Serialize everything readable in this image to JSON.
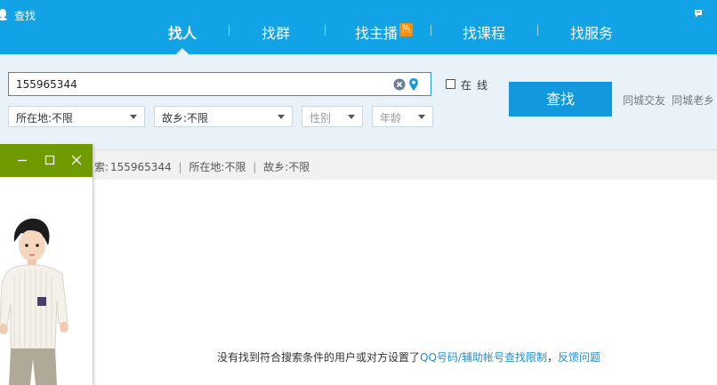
{
  "window": {
    "title": "查找"
  },
  "tabs": [
    {
      "label": "找人",
      "active": true
    },
    {
      "label": "找群",
      "active": false
    },
    {
      "label": "找主播",
      "active": false,
      "badge": "热"
    },
    {
      "label": "找课程",
      "active": false
    },
    {
      "label": "找服务",
      "active": false
    }
  ],
  "search": {
    "value": "155965344",
    "online_label": "在线",
    "online_checked": false,
    "button_label": "查找",
    "quick_links": [
      "同城交友",
      "同城老乡"
    ]
  },
  "filters": {
    "location": "所在地:不限",
    "hometown": "故乡:不限",
    "gender_placeholder": "性别",
    "age_placeholder": "年龄"
  },
  "summary": {
    "prefix": "索:",
    "keyword": "155965344",
    "location": "所在地:不限",
    "hometown": "故乡:不限"
  },
  "results": {
    "empty_text": "没有找到符合搜索条件的用户或对方设置了",
    "link_text": "QQ号码/辅助帐号查找限制",
    "separator": "，",
    "feedback_link": "反馈问题"
  },
  "colors": {
    "accent": "#12a2e6",
    "button": "#1298dd",
    "pet_titlebar": "#6f9a00",
    "link": "#1d8fd6"
  }
}
